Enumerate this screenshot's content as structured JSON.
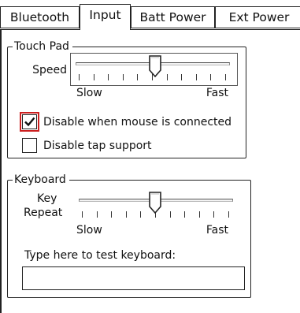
{
  "tabs": [
    {
      "label": "Bluetooth",
      "active": false
    },
    {
      "label": "Input",
      "active": true
    },
    {
      "label": "Batt Power",
      "active": false
    },
    {
      "label": "Ext Power",
      "active": false
    }
  ],
  "touchpad": {
    "title": "Touch Pad",
    "speed_label": "Speed",
    "speed_value": 0.52,
    "min_label": "Slow",
    "max_label": "Fast",
    "disable_with_mouse": {
      "label": "Disable when mouse is connected",
      "checked": true
    },
    "disable_tap": {
      "label": "Disable tap support",
      "checked": false
    }
  },
  "keyboard": {
    "title": "Keyboard",
    "repeat_label_1": "Key",
    "repeat_label_2": "Repeat",
    "repeat_value": 0.5,
    "min_label": "Slow",
    "max_label": "Fast",
    "test_label": "Type here to test keyboard:",
    "test_value": ""
  },
  "colors": {
    "focus_outline": "#cc1f1f"
  }
}
